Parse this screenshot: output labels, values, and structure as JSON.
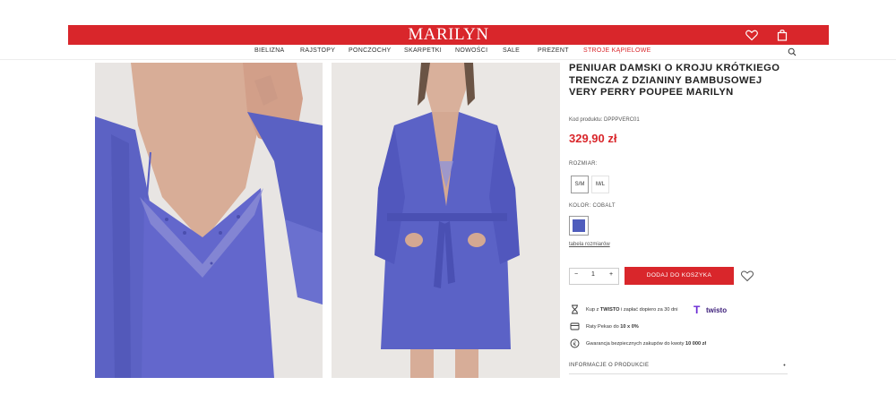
{
  "header": {
    "logo": "MARILYN",
    "icons": [
      "heart-icon",
      "shopping-bag-icon",
      "search-icon"
    ],
    "brand_color": "#d9262b"
  },
  "nav": {
    "items": [
      "BIELIZNA",
      "RAJSTOPY",
      "PONCZOCHY",
      "SKARPETKI",
      "NOWOŚCI",
      "SALE",
      "PREZENT",
      "STROJE KĄPIELOWE"
    ],
    "highlight_color": "#d9262b"
  },
  "product": {
    "title": "PENIUAR DAMSKI O KROJU KRÓTKIEGO TRENCZA Z DZIANINY BAMBUSOWEJ VERY PERRY POUPEE MARILYN",
    "code": "Kod produktu: DPPPVERC01",
    "price": "329,90 zł",
    "size_label": "ROZMIAR:",
    "sizes": [
      "S/M",
      "M/L"
    ],
    "color_label": "KOLOR: COBALT",
    "swatch_color": "#4f5dbc",
    "size_chart_link": "tabela rozmiarów",
    "quantity": {
      "minus": "−",
      "value": "1",
      "plus": "+"
    },
    "add_to_cart": "DODAJ DO KOSZYKA",
    "info": [
      {
        "icon": "hourglass-icon",
        "pre": "Kup z ",
        "strong": "TWISTO",
        "post": " i zapłać dopiero za 30 dni",
        "badge": "twisto"
      },
      {
        "icon": "credit-card-icon",
        "pre": "Raty Pekao do ",
        "strong": "10 x 0%",
        "post": ""
      },
      {
        "icon": "shield-coin-icon",
        "pre": "Gwarancja bezpiecznych zakupów do kwoty ",
        "strong": "10 000 zł",
        "post": ""
      }
    ],
    "accordion": "INFORMACJE O PRODUKCIE"
  }
}
